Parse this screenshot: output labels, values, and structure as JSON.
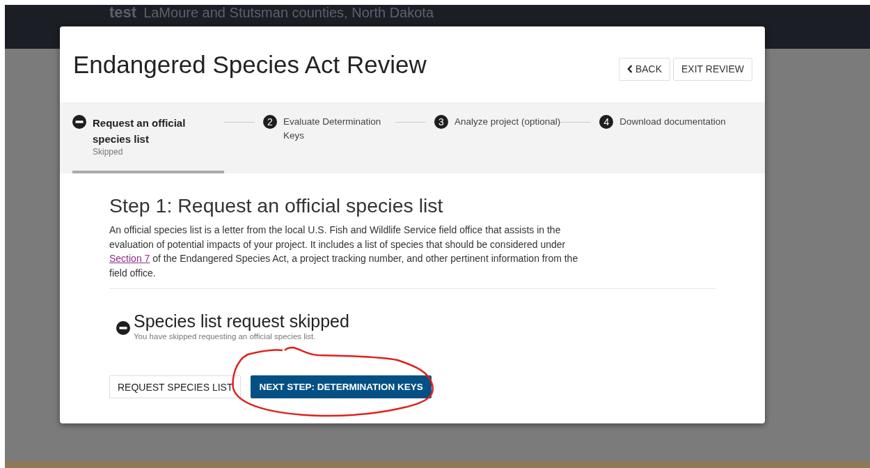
{
  "background": {
    "project_name": "test",
    "location": "LaMoure and Stutsman counties, North Dakota"
  },
  "modal": {
    "title": "Endangered Species Act Review",
    "buttons": [
      {
        "kind": "back",
        "label": "BACK"
      },
      {
        "kind": "plain",
        "label": "EXIT REVIEW"
      }
    ],
    "steps": [
      {
        "kind": "skipped",
        "label": "Request an official species list",
        "sublabel": "Skipped",
        "selected": true
      },
      {
        "kind": "numbered",
        "number": "2",
        "label": "Evaluate Determination Keys",
        "selected": false
      },
      {
        "kind": "numbered",
        "number": "3",
        "label": "Analyze project (optional)",
        "selected": false
      },
      {
        "kind": "numbered",
        "number": "4",
        "label": "Download documentation",
        "selected": false
      }
    ],
    "step_heading": "Step 1: Request an official species list",
    "description": {
      "before": "An official species list is a letter from the local U.S. Fish and Wildlife Service field office that assists in the evaluation of potential impacts of your project. It includes a list of species that should be considered under",
      "link": "Section 7",
      "after": "of the Endangered Species Act, a project tracking number, and other pertinent information from the field office."
    },
    "result": {
      "heading": "Species list request skipped",
      "message": "You have skipped requesting an official species list."
    },
    "actions": [
      {
        "kind": "secondary",
        "label": "REQUEST SPECIES LIST",
        "circled": false
      },
      {
        "kind": "primary",
        "label": "NEXT STEP: DETERMINATION KEYS",
        "circled": true
      }
    ]
  }
}
